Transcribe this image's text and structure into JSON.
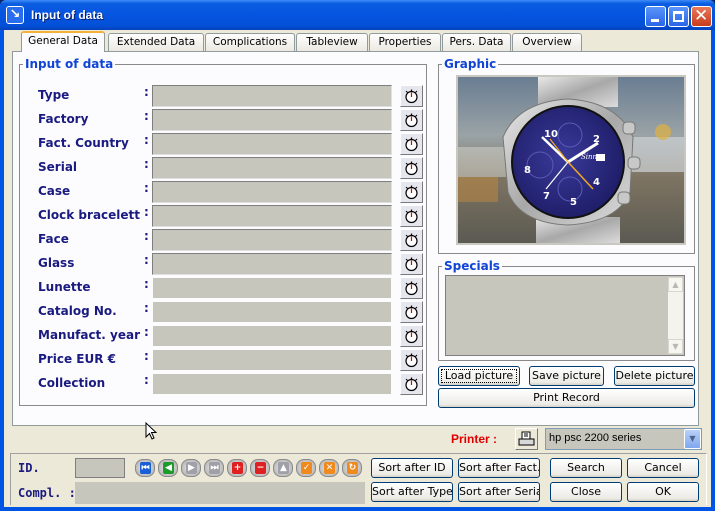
{
  "window": {
    "title": "Input of data",
    "icon": "arrow-down-right-icon",
    "controls": [
      "minimize",
      "maximize",
      "close"
    ]
  },
  "tabs": [
    {
      "label": "General Data",
      "active": true
    },
    {
      "label": "Extended Data",
      "active": false
    },
    {
      "label": "Complications",
      "active": false
    },
    {
      "label": "Tableview",
      "active": false
    },
    {
      "label": "Properties",
      "active": false
    },
    {
      "label": "Pers. Data",
      "active": false
    },
    {
      "label": "Overview",
      "active": false
    }
  ],
  "input_group": {
    "title": "Input of data",
    "colon": ":",
    "fields": [
      {
        "label": "Type",
        "value": ""
      },
      {
        "label": "Factory",
        "value": ""
      },
      {
        "label": "Fact. Country",
        "value": ""
      },
      {
        "label": "Serial",
        "value": ""
      },
      {
        "label": "Case",
        "value": ""
      },
      {
        "label": "Clock bracelett",
        "value": ""
      },
      {
        "label": "Face",
        "value": ""
      },
      {
        "label": "Glass",
        "value": ""
      },
      {
        "label": "Lunette",
        "value": ""
      },
      {
        "label": "Catalog No.",
        "value": ""
      },
      {
        "label": "Manufact. year",
        "value": ""
      },
      {
        "label": "Price     EUR €",
        "value": ""
      },
      {
        "label": "Collection",
        "value": ""
      }
    ],
    "picker_icon": "stopwatch-icon"
  },
  "graphic": {
    "title": "Graphic",
    "image_description": "Sinn chronograph wristwatch with blue dial on metal bracelet, blurred airport background",
    "dial_brand": "Sinn"
  },
  "specials": {
    "title": "Specials",
    "value": ""
  },
  "picture_buttons": {
    "load": "Load picture",
    "save": "Save picture",
    "delete": "Delete picture",
    "print": "Print Record"
  },
  "printer": {
    "label": "Printer :",
    "selected": "hp psc 2200 series",
    "icon": "printer-icon"
  },
  "bottom": {
    "id_label": "ID.",
    "id_value": "",
    "compl_label": "Compl. :",
    "compl_value": "",
    "nav_buttons": [
      {
        "name": "first-record",
        "glyph": "⏮",
        "color": "#1a5fd6"
      },
      {
        "name": "previous-record",
        "glyph": "◀",
        "color": "#1e9a2a"
      },
      {
        "name": "next-record",
        "glyph": "▶",
        "color": "#a0a0a8"
      },
      {
        "name": "last-record",
        "glyph": "⏭",
        "color": "#a0a0a8"
      },
      {
        "name": "add-record",
        "glyph": "+",
        "color": "#e02020"
      },
      {
        "name": "delete-record",
        "glyph": "−",
        "color": "#e02020"
      },
      {
        "name": "edit-record",
        "glyph": "▲",
        "color": "#a0a0a8"
      },
      {
        "name": "post-record",
        "glyph": "✓",
        "color": "#f08a1c"
      },
      {
        "name": "cancel-edit",
        "glyph": "✕",
        "color": "#f08a1c"
      },
      {
        "name": "refresh-record",
        "glyph": "↻",
        "color": "#f08a1c"
      }
    ],
    "buttons": {
      "sort_id": "Sort after ID",
      "sort_fact": "Sort after Fact.",
      "search": "Search",
      "cancel": "Cancel",
      "sort_type": "Sort after Type",
      "sort_serial": "Sort after Serial",
      "close": "Close",
      "ok": "OK"
    }
  },
  "colors": {
    "label_text": "#1a1a80",
    "group_title": "#1044d4",
    "printer_label": "#e00000",
    "field_bg": "#c7c6bd",
    "tab_accent": "#f3b13b"
  }
}
